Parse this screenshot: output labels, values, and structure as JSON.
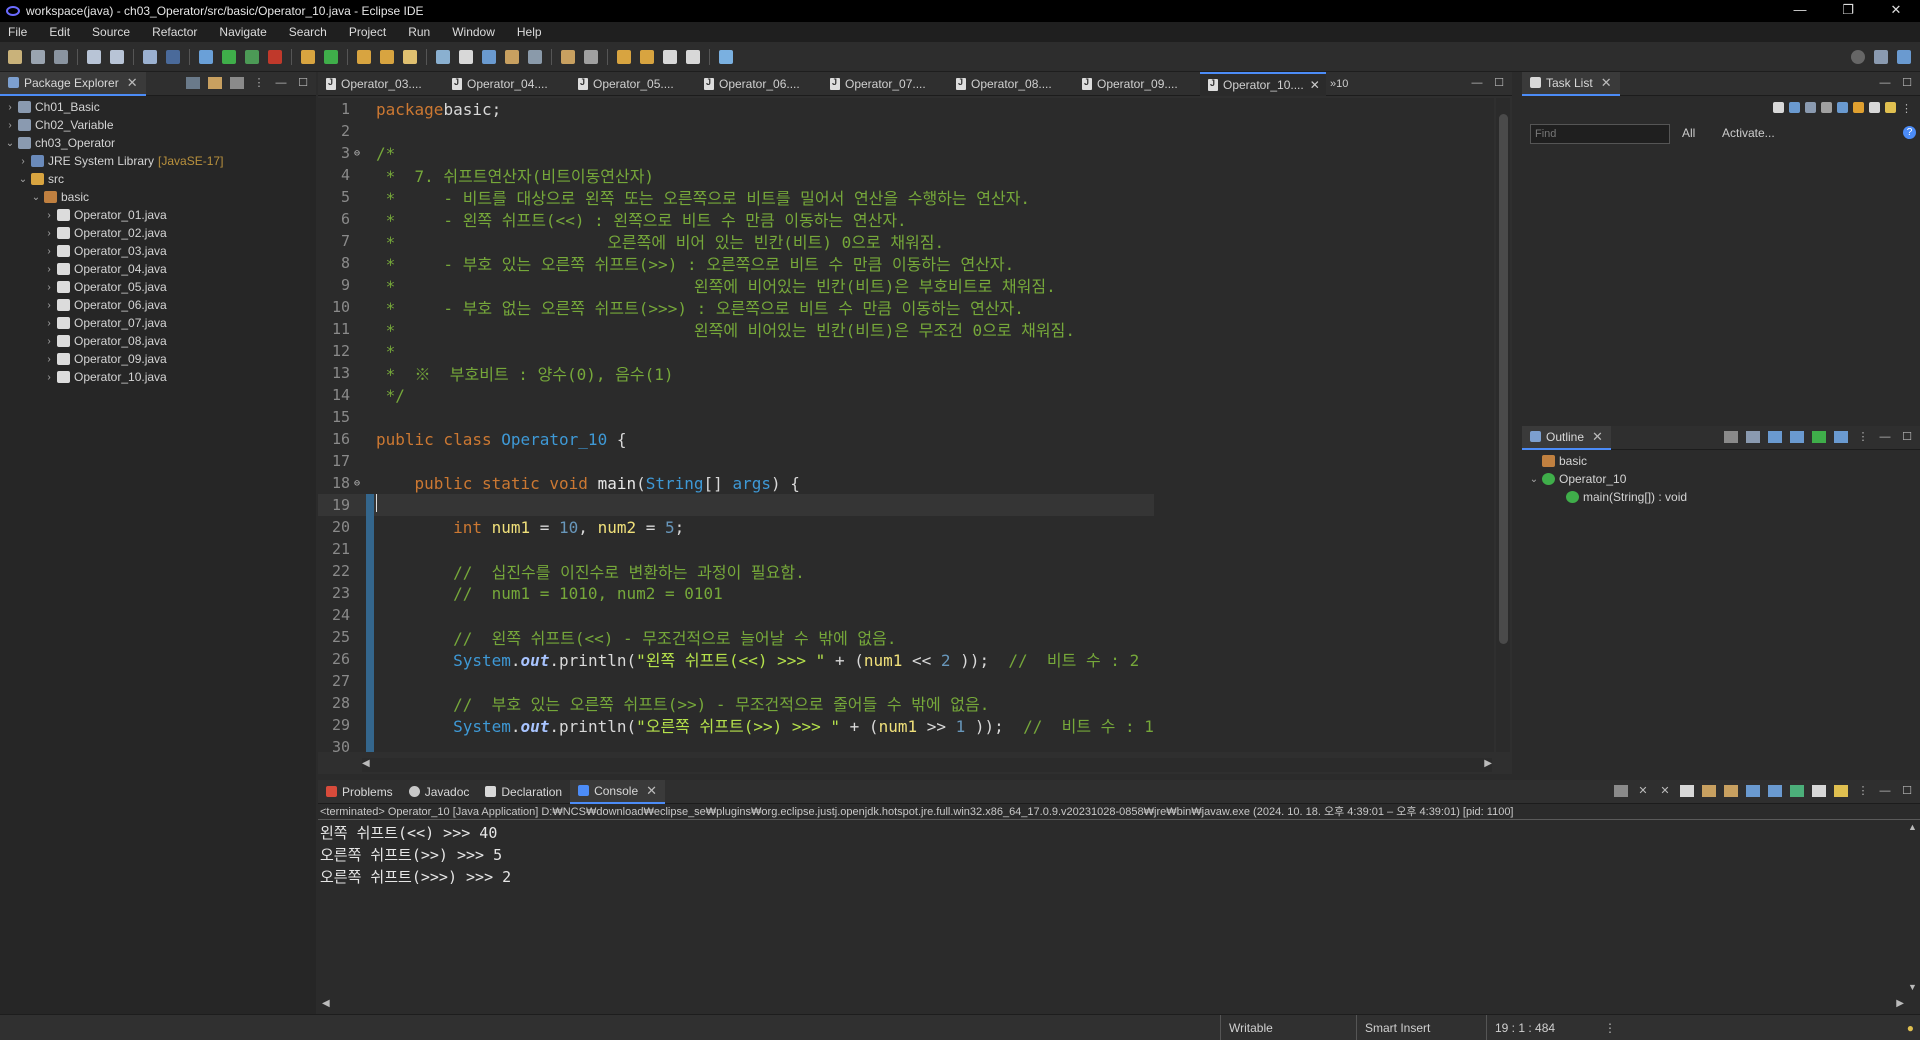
{
  "window": {
    "title": "workspace(java) - ch03_Operator/src/basic/Operator_10.java - Eclipse IDE",
    "controls": [
      "—",
      "❐",
      "✕"
    ]
  },
  "menu": [
    "File",
    "Edit",
    "Source",
    "Refactor",
    "Navigate",
    "Search",
    "Project",
    "Run",
    "Window",
    "Help"
  ],
  "package_explorer": {
    "title": "Package Explorer",
    "tree": [
      {
        "label": "Ch01_Basic",
        "indent": 0,
        "twisty": "›",
        "icon": "project-icon"
      },
      {
        "label": "Ch02_Variable",
        "indent": 0,
        "twisty": "›",
        "icon": "project-icon"
      },
      {
        "label": "ch03_Operator",
        "indent": 0,
        "twisty": "⌄",
        "icon": "project-icon"
      },
      {
        "label": "JRE System Library",
        "deco": "[JavaSE-17]",
        "indent": 1,
        "twisty": "›",
        "icon": "library-icon"
      },
      {
        "label": "src",
        "indent": 1,
        "twisty": "⌄",
        "icon": "source-folder-icon"
      },
      {
        "label": "basic",
        "indent": 2,
        "twisty": "⌄",
        "icon": "package-icon"
      },
      {
        "label": "Operator_01.java",
        "indent": 3,
        "twisty": "›",
        "icon": "java-file-icon"
      },
      {
        "label": "Operator_02.java",
        "indent": 3,
        "twisty": "›",
        "icon": "java-file-icon"
      },
      {
        "label": "Operator_03.java",
        "indent": 3,
        "twisty": "›",
        "icon": "java-file-icon"
      },
      {
        "label": "Operator_04.java",
        "indent": 3,
        "twisty": "›",
        "icon": "java-file-icon"
      },
      {
        "label": "Operator_05.java",
        "indent": 3,
        "twisty": "›",
        "icon": "java-file-icon"
      },
      {
        "label": "Operator_06.java",
        "indent": 3,
        "twisty": "›",
        "icon": "java-file-icon"
      },
      {
        "label": "Operator_07.java",
        "indent": 3,
        "twisty": "›",
        "icon": "java-file-icon"
      },
      {
        "label": "Operator_08.java",
        "indent": 3,
        "twisty": "›",
        "icon": "java-file-icon"
      },
      {
        "label": "Operator_09.java",
        "indent": 3,
        "twisty": "›",
        "icon": "java-file-icon"
      },
      {
        "label": "Operator_10.java",
        "indent": 3,
        "twisty": "›",
        "icon": "java-file-icon"
      }
    ]
  },
  "editor": {
    "tabs": [
      "Operator_03....",
      "Operator_04....",
      "Operator_05....",
      "Operator_06....",
      "Operator_07....",
      "Operator_08....",
      "Operator_09....",
      "Operator_10...."
    ],
    "active_tab": 7,
    "overflow": "»10",
    "current_line": 19,
    "lines": [
      {
        "n": "1",
        "mk": "",
        "t": [
          [
            "kw",
            "package"
          ],
          [
            "",
            "basic;"
          ]
        ]
      },
      {
        "n": "2",
        "mk": "",
        "t": []
      },
      {
        "n": "3",
        "mk": "⊖",
        "t": [
          [
            "cm",
            "/*"
          ]
        ]
      },
      {
        "n": "4",
        "mk": "",
        "t": [
          [
            "cm",
            " *  7. 쉬프트연산자(비트이동연산자)"
          ]
        ]
      },
      {
        "n": "5",
        "mk": "",
        "t": [
          [
            "cm",
            " *     - 비트를 대상으로 왼쪽 또는 오른쪽으로 비트를 밀어서 연산을 수행하는 연산자."
          ]
        ]
      },
      {
        "n": "6",
        "mk": "",
        "t": [
          [
            "cm",
            " *     - 왼쪽 쉬프트(<<) : 왼쪽으로 비트 수 만큼 이동하는 연산자."
          ]
        ]
      },
      {
        "n": "7",
        "mk": "",
        "t": [
          [
            "cm",
            " *                      오른쪽에 비어 있는 빈칸(비트) 0으로 채워짐."
          ]
        ]
      },
      {
        "n": "8",
        "mk": "",
        "t": [
          [
            "cm",
            " *     - 부호 있는 오른쪽 쉬프트(>>) : 오른쪽으로 비트 수 만큼 이동하는 연산자."
          ]
        ]
      },
      {
        "n": "9",
        "mk": "",
        "t": [
          [
            "cm",
            " *                               왼쪽에 비어있는 빈칸(비트)은 부호비트로 채워짐."
          ]
        ]
      },
      {
        "n": "10",
        "mk": "",
        "t": [
          [
            "cm",
            " *     - 부호 없는 오른쪽 쉬프트(>>>) : 오른쪽으로 비트 수 만큼 이동하는 연산자."
          ]
        ]
      },
      {
        "n": "11",
        "mk": "",
        "t": [
          [
            "cm",
            " *                               왼쪽에 비어있는 빈칸(비트)은 무조건 0으로 채워짐."
          ]
        ]
      },
      {
        "n": "12",
        "mk": "",
        "t": [
          [
            "cm",
            " *"
          ]
        ]
      },
      {
        "n": "13",
        "mk": "",
        "t": [
          [
            "cm",
            " *  ※  부호비트 : 양수(0), 음수(1)"
          ]
        ]
      },
      {
        "n": "14",
        "mk": "",
        "t": [
          [
            "cm",
            " */"
          ]
        ]
      },
      {
        "n": "15",
        "mk": "",
        "t": []
      },
      {
        "n": "16",
        "mk": "",
        "t": [
          [
            "kw",
            "public class "
          ],
          [
            "ty",
            "Operator_10"
          ],
          [
            "",
            " {"
          ]
        ]
      },
      {
        "n": "17",
        "mk": "",
        "t": []
      },
      {
        "n": "18",
        "mk": "⊖",
        "t": [
          [
            "",
            "    "
          ],
          [
            "kw",
            "public static void "
          ],
          [
            "method",
            "main"
          ],
          [
            "",
            "("
          ],
          [
            "ty",
            "String"
          ],
          [
            "",
            "[] "
          ],
          [
            "ty",
            "args"
          ],
          [
            "",
            ") {"
          ]
        ]
      },
      {
        "n": "19",
        "mk": "",
        "t": [
          [
            "",
            ""
          ]
        ]
      },
      {
        "n": "20",
        "mk": "",
        "t": [
          [
            "",
            "        "
          ],
          [
            "kw",
            "int "
          ],
          [
            "var",
            "num1"
          ],
          [
            "",
            " = "
          ],
          [
            "num",
            "10"
          ],
          [
            "",
            ", "
          ],
          [
            "var",
            "num2"
          ],
          [
            "",
            " = "
          ],
          [
            "num",
            "5"
          ],
          [
            "",
            ";"
          ]
        ]
      },
      {
        "n": "21",
        "mk": "",
        "t": []
      },
      {
        "n": "22",
        "mk": "",
        "t": [
          [
            "",
            "        "
          ],
          [
            "cm",
            "//  십진수를 이진수로 변환하는 과정이 필요함."
          ]
        ]
      },
      {
        "n": "23",
        "mk": "",
        "t": [
          [
            "",
            "        "
          ],
          [
            "cm",
            "//  num1 = 1010, num2 = 0101"
          ]
        ]
      },
      {
        "n": "24",
        "mk": "",
        "t": []
      },
      {
        "n": "25",
        "mk": "",
        "t": [
          [
            "",
            "        "
          ],
          [
            "cm",
            "//  왼쪽 쉬프트(<<) - 무조건적으로 늘어날 수 밖에 없음."
          ]
        ]
      },
      {
        "n": "26",
        "mk": "",
        "t": [
          [
            "",
            "        "
          ],
          [
            "ty",
            "System"
          ],
          [
            "",
            "."
          ],
          [
            "field",
            "out"
          ],
          [
            "",
            ".println("
          ],
          [
            "str",
            "\"왼쪽 쉬프트(<<) >>> \""
          ],
          [
            "",
            " + ("
          ],
          [
            "var",
            "num1"
          ],
          [
            "",
            " << "
          ],
          [
            "num",
            "2"
          ],
          [
            "",
            " ));  "
          ],
          [
            "cm",
            "//  비트 수 : 2"
          ]
        ]
      },
      {
        "n": "27",
        "mk": "",
        "t": []
      },
      {
        "n": "28",
        "mk": "",
        "t": [
          [
            "",
            "        "
          ],
          [
            "cm",
            "//  부호 있는 오른쪽 쉬프트(>>) - 무조건적으로 줄어들 수 밖에 없음."
          ]
        ]
      },
      {
        "n": "29",
        "mk": "",
        "t": [
          [
            "",
            "        "
          ],
          [
            "ty",
            "System"
          ],
          [
            "",
            "."
          ],
          [
            "field",
            "out"
          ],
          [
            "",
            ".println("
          ],
          [
            "str",
            "\"오른쪽 쉬프트(>>) >>> \""
          ],
          [
            "",
            " + ("
          ],
          [
            "var",
            "num1"
          ],
          [
            "",
            " >> "
          ],
          [
            "num",
            "1"
          ],
          [
            "",
            " ));  "
          ],
          [
            "cm",
            "//  비트 수 : 1"
          ]
        ]
      },
      {
        "n": "30",
        "mk": "",
        "t": []
      }
    ]
  },
  "task_list": {
    "title": "Task List",
    "find_placeholder": "Find",
    "all_label": "All",
    "activate_label": "Activate..."
  },
  "outline": {
    "title": "Outline",
    "items": [
      {
        "label": "basic",
        "indent": 0,
        "icon": "package-icon",
        "twisty": ""
      },
      {
        "label": "Operator_10",
        "indent": 0,
        "icon": "class-icon",
        "twisty": "⌄"
      },
      {
        "label": "main(String[]) : void",
        "indent": 1,
        "icon": "method-icon",
        "twisty": ""
      }
    ]
  },
  "console": {
    "tabs": [
      "Problems",
      "Javadoc",
      "Declaration",
      "Console"
    ],
    "active_tab": 3,
    "status": "<terminated> Operator_10 [Java Application] D:₩NCS₩download₩eclipse_se₩plugins₩org.eclipse.justj.openjdk.hotspot.jre.full.win32.x86_64_17.0.9.v20231028-0858₩jre₩bin₩javaw.exe  (2024. 10. 18. 오후 4:39:01 – 오후 4:39:01) [pid: 1100]",
    "output": [
      "왼쪽 쉬프트(<<) >>> 40",
      "오른쪽 쉬프트(>>) >>> 5",
      "오른쪽 쉬프트(>>>) >>> 2"
    ]
  },
  "statusbar": {
    "writable": "Writable",
    "insert_mode": "Smart Insert",
    "position": "19 : 1 : 484"
  },
  "colors": {
    "accent": "#4c8cf7",
    "comment": "#76a83a",
    "keyword": "#cc7832"
  }
}
